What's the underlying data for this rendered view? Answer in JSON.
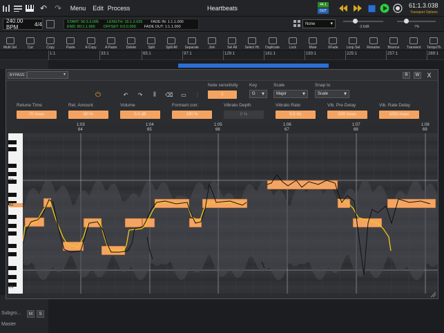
{
  "topbar": {
    "menu_label": "Menu",
    "edit_label": "Edit",
    "process_label": "Process",
    "title": "Heartbeats",
    "rate_badge": "44.1",
    "out_badge": "OUT",
    "position": "61:1.3.038",
    "transport_options": "Transport Options"
  },
  "row2": {
    "bpm": "240.00 BPM",
    "meter": "4/4",
    "start": "START: 56:3.3.095",
    "end": "END: 80:1.1.066",
    "length": "LENGTH: 16:1.2.025",
    "offset": "OFFSET: 0:0.0.000",
    "fade_in": "FADE IN: 1:1.1.000",
    "fade_out": "FADE OUT: 1:1.1.000",
    "snap": "None",
    "vol_db": "-3.6dB",
    "pan": "7%"
  },
  "toolbar": {
    "items": [
      "Multi Sel",
      "Cut",
      "Copy",
      "Paste",
      "A Copy",
      "A Paste",
      "Delete",
      "Split",
      "Split All",
      "Separate",
      "Join",
      "Sel All",
      "Select HL",
      "Duplicate",
      "Lock",
      "Mute",
      "XFade",
      "Loop Sel",
      "Rename",
      "Bounce",
      "Transient",
      "TempoTk"
    ]
  },
  "ruler": {
    "marks": [
      "1:1",
      "33:1",
      "65:1",
      "97:1",
      "129:1",
      "161:1",
      "193:1",
      "225:1",
      "257:1",
      "289:1"
    ]
  },
  "tracks": {
    "subgroup_label": "Subgro...",
    "master_label": "Master",
    "m_label": "M",
    "s_label": "S"
  },
  "plugin": {
    "bypass_label": "BYPASS",
    "btn_r": "R",
    "btn_w": "W",
    "btn_x": "X",
    "note_sensitivity": {
      "label": "Note sensitivity",
      "value": "1"
    },
    "key": {
      "label": "Key",
      "value": "G"
    },
    "scale": {
      "label": "Scale",
      "value": "Major"
    },
    "snap_to": {
      "label": "Snap to",
      "value": "Scale"
    },
    "params": [
      {
        "label": "Retune Time",
        "value": "70 msec",
        "active": true
      },
      {
        "label": "Ret. Amount",
        "value": "80 %",
        "active": true
      },
      {
        "label": "Volume",
        "value": "0.0 dB",
        "active": true
      },
      {
        "label": "Formant corr.",
        "value": "100 %",
        "active": true
      },
      {
        "label": "Vibrato Depth",
        "value": "0 %",
        "active": false
      },
      {
        "label": "Vibrato Rate",
        "value": "5.0 Hz",
        "active": true
      },
      {
        "label": "Vib. Pre Delay",
        "value": "500 msec",
        "active": true
      },
      {
        "label": "Vib. Rate Delay",
        "value": "1000 msec",
        "active": true
      }
    ],
    "graph_ruler_times": [
      "1:03",
      "1:04",
      "1:05",
      "1:06",
      "1:07",
      "1:08"
    ],
    "graph_ruler_bars": [
      "64",
      "65",
      "66",
      "67",
      "68",
      "69"
    ],
    "piano_labels": {
      "c4": "C4",
      "a3": "A3",
      "c3": "C3"
    }
  },
  "colors": {
    "accent_orange": "#f4a462",
    "pitch_yellow": "#f5c518",
    "transport_green": "#2ecc40",
    "loop_blue": "#2b6fd6"
  }
}
